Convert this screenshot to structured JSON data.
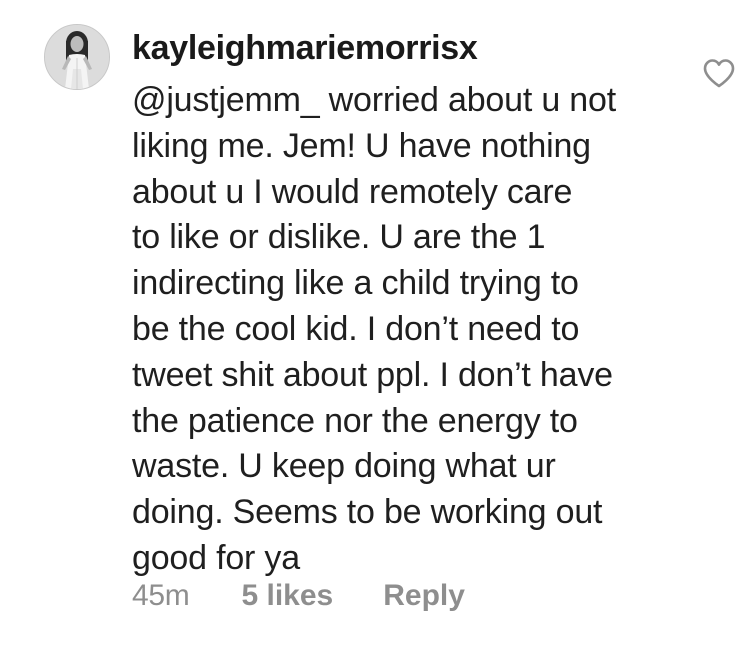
{
  "comment": {
    "username": "kayleighmariemorrisx",
    "text_lines": [
      "@justjemm_ worried about u not",
      "liking me. Jem! U have nothing",
      "about u I would remotely care",
      "to like or dislike. U are the 1",
      "indirecting like a child trying to",
      "be the cool kid. I don’t need to",
      "tweet shit about ppl. I don’t have",
      "the patience nor the energy to",
      "waste. U keep doing what ur",
      "doing. Seems to be working out",
      "good for ya"
    ],
    "time": "45m",
    "likes": "5 likes",
    "reply_label": "Reply",
    "like_icon": "heart-outline-icon"
  },
  "colors": {
    "text": "#1f1f1f",
    "meta": "#8e8e8e",
    "icon": "#8e8e8e"
  }
}
